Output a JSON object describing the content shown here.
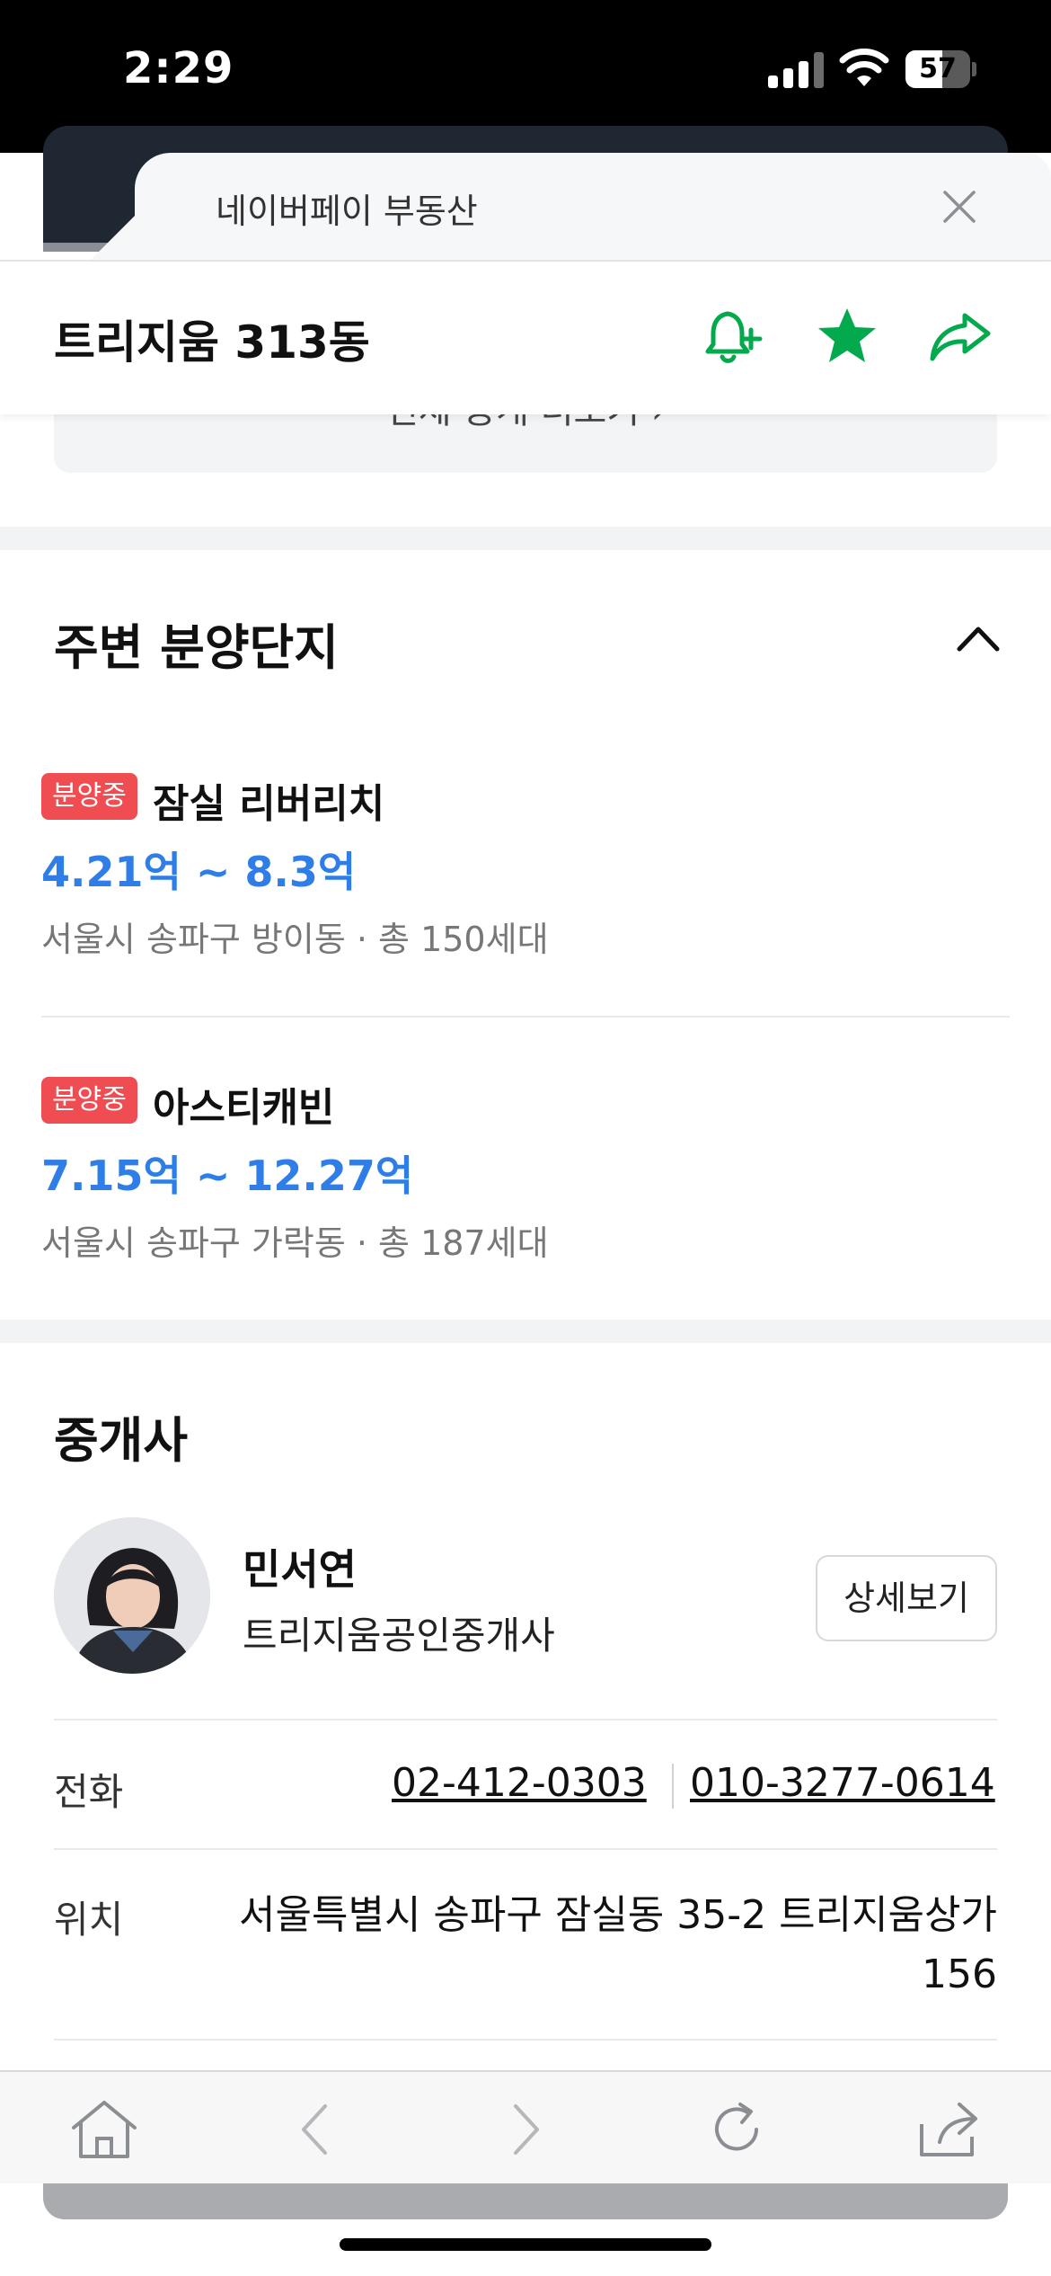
{
  "status": {
    "time": "2:29",
    "battery": "57",
    "battery_level": 0.57
  },
  "sheet": {
    "title": "네이버페이 부동산"
  },
  "header": {
    "title": "트리지움 313동"
  },
  "hidden_button": {
    "label": "전체 중개 더보기 ›"
  },
  "nearby": {
    "title": "주변 분양단지",
    "items": [
      {
        "badge": "분양중",
        "name": "잠실 리버리치",
        "price": "4.21억 ~ 8.3억",
        "meta": "서울시 송파구 방이동 · 총 150세대"
      },
      {
        "badge": "분양중",
        "name": "아스티캐빈",
        "price": "7.15억 ~ 12.27억",
        "meta": "서울시 송파구 가락동 · 총 187세대"
      }
    ]
  },
  "agent": {
    "title": "중개사",
    "name": "민서연",
    "office": "트리지움공인중개사",
    "detail_label": "상세보기",
    "phone_label": "전화",
    "phone1": "02-412-0303",
    "phone2": "010-3277-0614",
    "location_label": "위치",
    "address": "서울특별시 송파구 잠실동 35-2 트리지움상가 156"
  },
  "colors": {
    "brand_green": "#03a94d",
    "price_blue": "#2f7ee8",
    "badge_red": "#f04d52"
  },
  "icons": {
    "header": [
      "bell-plus-icon",
      "star-icon",
      "share-icon"
    ],
    "toolbar": [
      "home-icon",
      "back-icon",
      "forward-icon",
      "reload-icon",
      "share-icon"
    ]
  }
}
